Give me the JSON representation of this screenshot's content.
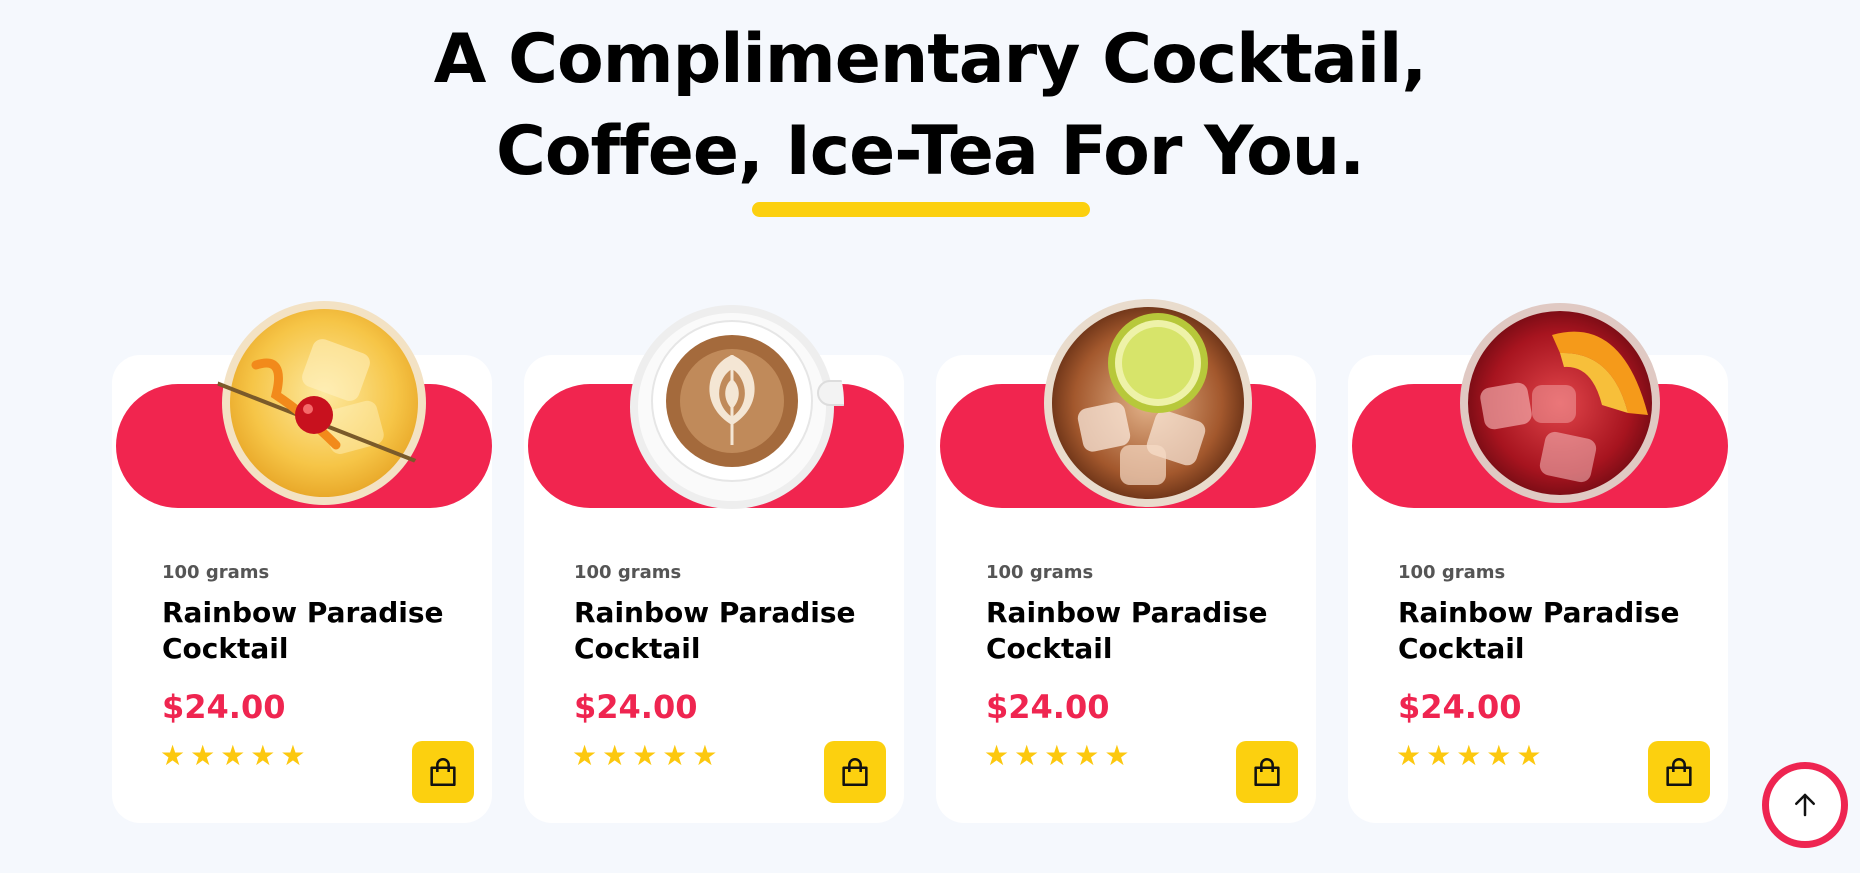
{
  "section": {
    "heading_line1": "A Complimentary Cocktail,",
    "heading_line2": "Coffee, Ice-Tea For You."
  },
  "colors": {
    "accent_red": "#f1254f",
    "accent_yellow": "#fcd00f",
    "background": "#f5f8fd",
    "card": "#ffffff"
  },
  "products": [
    {
      "image_icon": "cocktail-glass-icon",
      "weight": "100 grams",
      "title": "Rainbow Paradise Cocktail",
      "price": "$24.00",
      "rating": 5,
      "stars": "★★★★★",
      "cart_icon": "shopping-bag-icon"
    },
    {
      "image_icon": "coffee-cup-icon",
      "weight": "100 grams",
      "title": "Rainbow Paradise Cocktail",
      "price": "$24.00",
      "rating": 5,
      "stars": "★★★★★",
      "cart_icon": "shopping-bag-icon"
    },
    {
      "image_icon": "ice-cola-glass-icon",
      "weight": "100 grams",
      "title": "Rainbow Paradise Cocktail",
      "price": "$24.00",
      "rating": 5,
      "stars": "★★★★★",
      "cart_icon": "shopping-bag-icon"
    },
    {
      "image_icon": "red-cocktail-orange-icon",
      "weight": "100 grams",
      "title": "Rainbow Paradise Cocktail",
      "price": "$24.00",
      "rating": 5,
      "stars": "★★★★★",
      "cart_icon": "shopping-bag-icon"
    }
  ],
  "scroll_top_icon": "arrow-up-icon"
}
